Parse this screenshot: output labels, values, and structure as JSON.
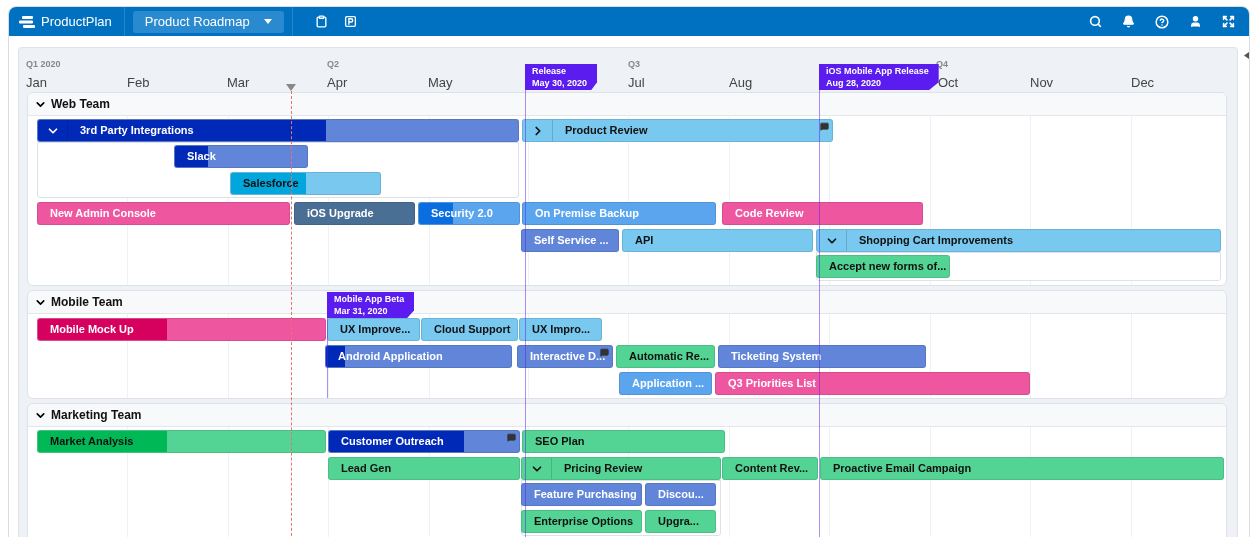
{
  "app": {
    "brand": "ProductPlan",
    "roadmap_menu": "Product Roadmap"
  },
  "timeline": {
    "quarters": [
      "Q1 2020",
      "Q2",
      "Q3",
      "Q4"
    ],
    "months": [
      "Jan",
      "Feb",
      "Mar",
      "Apr",
      "May",
      "Jul",
      "Aug",
      "Oct",
      "Nov",
      "Dec"
    ]
  },
  "milestones": [
    {
      "label": "Release",
      "date": "May 30, 2020",
      "color": "#5b1cf0"
    },
    {
      "label": "iOS Mobile App Release",
      "date": "Aug 28, 2020",
      "color": "#5b1cf0"
    }
  ],
  "lanes": [
    {
      "name": "Web Team",
      "expanded": true,
      "bars": [
        {
          "label": "3rd Party Integrations",
          "color": "#6185d8",
          "level": 0.6,
          "expanded": true,
          "children": [
            {
              "label": "Slack",
              "color": "#6185d8",
              "level": 0.25
            },
            {
              "label": "Salesforce",
              "color": "#78c8ef",
              "level": 0.5
            }
          ]
        },
        {
          "label": "Product Review",
          "color": "#78c8ef",
          "expanded": false,
          "comments": true
        },
        {
          "label": "New Admin Console",
          "color": "#ef56a0"
        },
        {
          "label": "iOS Upgrade",
          "color": "#4a6f95"
        },
        {
          "label": "Security 2.0",
          "color": "#5aa5ee",
          "level": 0.34
        },
        {
          "label": "On Premise Backup",
          "color": "#5aa5ee"
        },
        {
          "label": "Code Review",
          "color": "#ef56a0"
        },
        {
          "label": "Self Service ...",
          "color": "#6185d8"
        },
        {
          "label": "API",
          "color": "#78c8ef"
        },
        {
          "label": "Shopping Cart Improvements",
          "color": "#78c8ef",
          "expanded": true,
          "children": [
            {
              "label": "Accept new forms of...",
              "color": "#53d495"
            }
          ]
        }
      ]
    },
    {
      "name": "Mobile Team",
      "expanded": true,
      "milestones": [
        {
          "label": "Mobile App Beta",
          "date": "Mar 31, 2020",
          "color": "#5b1cf0"
        }
      ],
      "bars": [
        {
          "label": "Mobile Mock Up",
          "color": "#ef56a0",
          "level": 0.45
        },
        {
          "label": "UX Improve...",
          "color": "#78c8ef"
        },
        {
          "label": "Cloud Support",
          "color": "#78c8ef"
        },
        {
          "label": "UX Impro...",
          "color": "#78c8ef"
        },
        {
          "label": "Android Application",
          "color": "#6185d8",
          "level": 0.1
        },
        {
          "label": "Interactive D...",
          "color": "#6185d8",
          "comments": true
        },
        {
          "label": "Automatic Re...",
          "color": "#53d495"
        },
        {
          "label": "Ticketing System",
          "color": "#6185d8"
        },
        {
          "label": "Application ...",
          "color": "#5aa5ee"
        },
        {
          "label": "Q3 Priorities List",
          "color": "#ef56a0"
        }
      ]
    },
    {
      "name": "Marketing Team",
      "expanded": true,
      "bars": [
        {
          "label": "Market Analysis",
          "color": "#53d495",
          "level": 0.45
        },
        {
          "label": "Customer Outreach",
          "color": "#6185d8",
          "level": 0.71,
          "comments": true
        },
        {
          "label": "SEO Plan",
          "color": "#53d495"
        },
        {
          "label": "Lead Gen",
          "color": "#53d495"
        },
        {
          "label": "Pricing Review",
          "color": "#53d495",
          "expanded": true,
          "children": [
            {
              "label": "Feature Purchasing",
              "color": "#6185d8"
            },
            {
              "label": "Discou...",
              "color": "#6185d8"
            },
            {
              "label": "Enterprise Options",
              "color": "#53d495"
            },
            {
              "label": "Upgra...",
              "color": "#53d495"
            }
          ]
        },
        {
          "label": "Content Rev...",
          "color": "#53d495"
        },
        {
          "label": "Proactive Email Campaign",
          "color": "#53d495"
        }
      ]
    }
  ]
}
